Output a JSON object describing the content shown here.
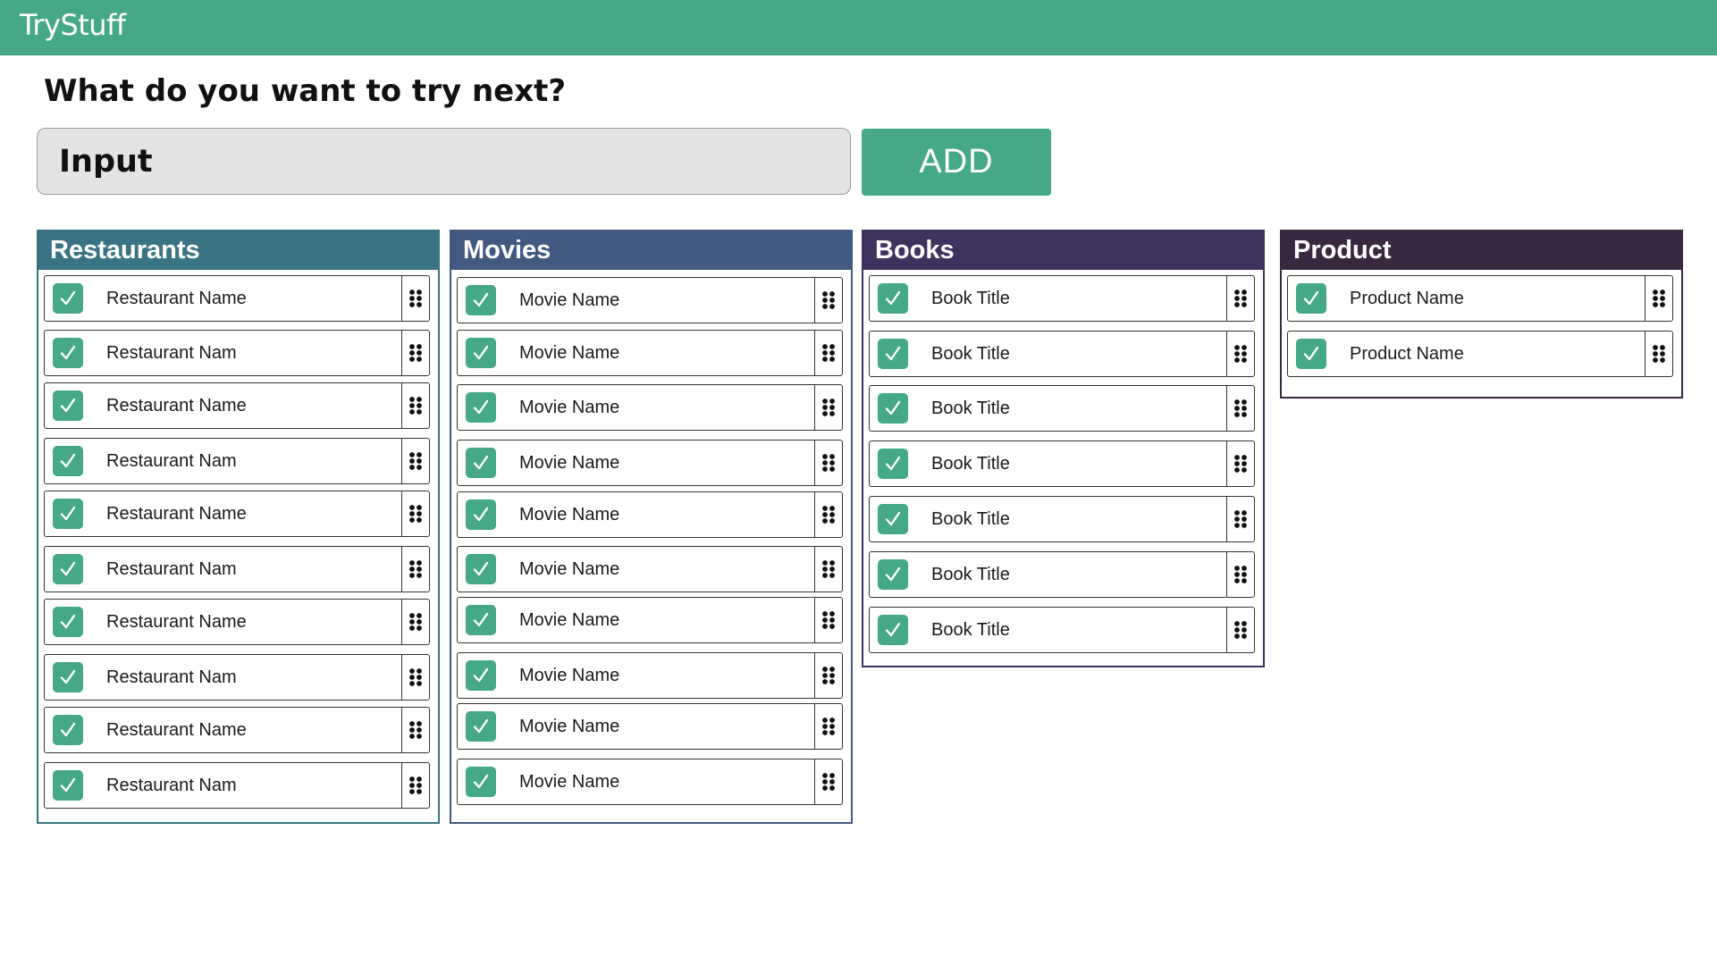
{
  "app": {
    "title": "TryStuff"
  },
  "prompt": "What do you want to try next?",
  "input": {
    "placeholder": "Input"
  },
  "add_button": {
    "label": "ADD"
  },
  "colors": {
    "accent": "#45a985",
    "restaurants": "#3a7383",
    "movies": "#425981",
    "books": "#3f325f",
    "product": "#3a2840"
  },
  "columns": [
    {
      "key": "restaurants",
      "title": "Restaurants",
      "items": [
        {
          "label": "Restaurant Name",
          "checked": true
        },
        {
          "label": "Restaurant Nam",
          "checked": true
        },
        {
          "label": "Restaurant Name",
          "checked": true
        },
        {
          "label": "Restaurant Nam",
          "checked": true
        },
        {
          "label": "Restaurant Name",
          "checked": true
        },
        {
          "label": "Restaurant Nam",
          "checked": true
        },
        {
          "label": "Restaurant Name",
          "checked": true
        },
        {
          "label": "Restaurant Nam",
          "checked": true
        },
        {
          "label": "Restaurant Name",
          "checked": true
        },
        {
          "label": "Restaurant Nam",
          "checked": true
        }
      ]
    },
    {
      "key": "movies",
      "title": "Movies",
      "items": [
        {
          "label": "Movie Name",
          "checked": true
        },
        {
          "label": "Movie Name",
          "checked": true
        },
        {
          "label": "Movie Name",
          "checked": true
        },
        {
          "label": "Movie Name",
          "checked": true
        },
        {
          "label": "Movie Name",
          "checked": true
        },
        {
          "label": "Movie Name",
          "checked": true
        },
        {
          "label": "Movie Name",
          "checked": true
        },
        {
          "label": "Movie Name",
          "checked": true
        },
        {
          "label": "Movie Name",
          "checked": true
        },
        {
          "label": "Movie Name",
          "checked": true
        }
      ]
    },
    {
      "key": "books",
      "title": "Books",
      "items": [
        {
          "label": "Book Title",
          "checked": true
        },
        {
          "label": "Book Title",
          "checked": true
        },
        {
          "label": "Book Title",
          "checked": true
        },
        {
          "label": "Book Title",
          "checked": true
        },
        {
          "label": "Book Title",
          "checked": true
        },
        {
          "label": "Book Title",
          "checked": true
        },
        {
          "label": "Book Title",
          "checked": true
        }
      ]
    },
    {
      "key": "product",
      "title": "Product",
      "items": [
        {
          "label": "Product Name",
          "checked": true
        },
        {
          "label": "Product Name",
          "checked": true
        }
      ]
    }
  ]
}
